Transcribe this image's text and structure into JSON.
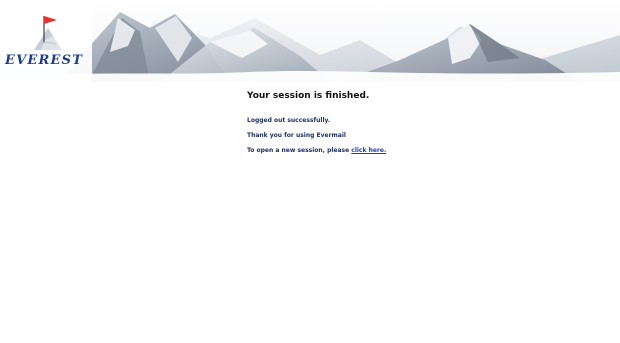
{
  "brand": {
    "logo_text": "EVEREST"
  },
  "session": {
    "title": "Your session is finished.",
    "logged_out": "Logged out successfully.",
    "thanks": "Thank you for using Evermail",
    "reopen_prefix": "To open a new session, please ",
    "reopen_link": "click here."
  },
  "colors": {
    "background": "#ffffff",
    "logo_blue": "#1e3d8f",
    "text_dark": "#111111",
    "text_navy": "#1f2f62",
    "link_blue": "#1e3bbd",
    "flag_red": "#e3312f"
  },
  "icons": {
    "logo": "everest-flag-icon",
    "banner": "mountain-banner-image"
  }
}
